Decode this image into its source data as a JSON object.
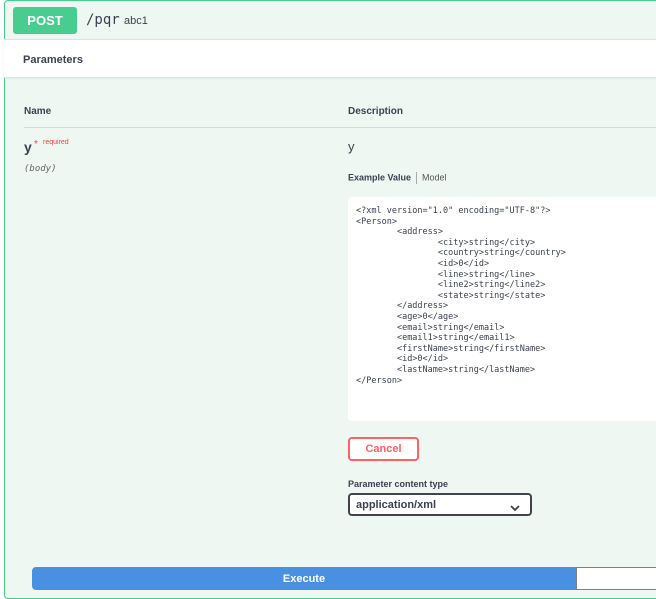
{
  "operation": {
    "method": "POST",
    "path": "/pqr",
    "summary": "abc1",
    "accent_color": "#49cc90"
  },
  "parameters_section": {
    "title": "Parameters",
    "columns": {
      "name": "Name",
      "description": "Description"
    }
  },
  "parameter": {
    "name": "y",
    "required_star": "*",
    "required_label": "required",
    "in": "(body)",
    "description": "y",
    "tabs": {
      "example_value": "Example Value",
      "model": "Model"
    },
    "example_value": "<?xml version=\"1.0\" encoding=\"UTF-8\"?>\n<Person>\n\t<address>\n\t\t<city>string</city>\n\t\t<country>string</country>\n\t\t<id>0</id>\n\t\t<line>string</line>\n\t\t<line2>string</line2>\n\t\t<state>string</state>\n\t</address>\n\t<age>0</age>\n\t<email>string</email>\n\t<email1>string</email1>\n\t<firstName>string</firstName>\n\t<id>0</id>\n\t<lastName>string</lastName>\n</Person>"
  },
  "buttons": {
    "cancel": "Cancel",
    "execute": "Execute",
    "cancel_color": "#ff6060",
    "execute_color": "#4990e2"
  },
  "content_type": {
    "label": "Parameter content type",
    "selected": "application/xml",
    "icon": "chevron-down-icon"
  }
}
